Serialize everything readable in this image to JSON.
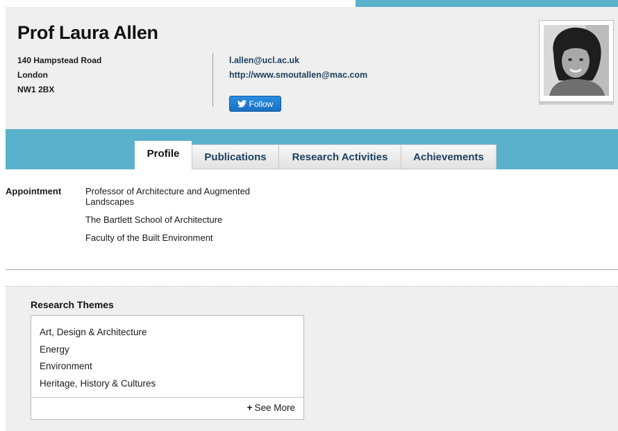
{
  "profile": {
    "name": "Prof Laura Allen",
    "address": [
      "140 Hampstead Road",
      "London",
      "NW1 2BX"
    ],
    "email": "l.allen@ucl.ac.uk",
    "website": "http://www.smoutallen@mac.com",
    "follow_label": "Follow"
  },
  "tabs": [
    "Profile",
    "Publications",
    "Research Activities",
    "Achievements"
  ],
  "active_tab": "Profile",
  "appointment": {
    "label": "Appointment",
    "lines": [
      "Professor of Architecture and Augmented Landscapes",
      "The Bartlett School of Architecture",
      "Faculty of the Built Environment"
    ]
  },
  "research_themes": {
    "title": "Research Themes",
    "items": [
      "Art, Design & Architecture",
      "Energy",
      "Environment",
      "Heritage, History & Cultures"
    ],
    "see_more": "See More",
    "see_more_icon": "+"
  },
  "colors": {
    "accent_blue": "#5ab1cc",
    "header_bg": "#efefef",
    "link": "#1c3f5e",
    "twitter_button": "#1a6fc2"
  }
}
